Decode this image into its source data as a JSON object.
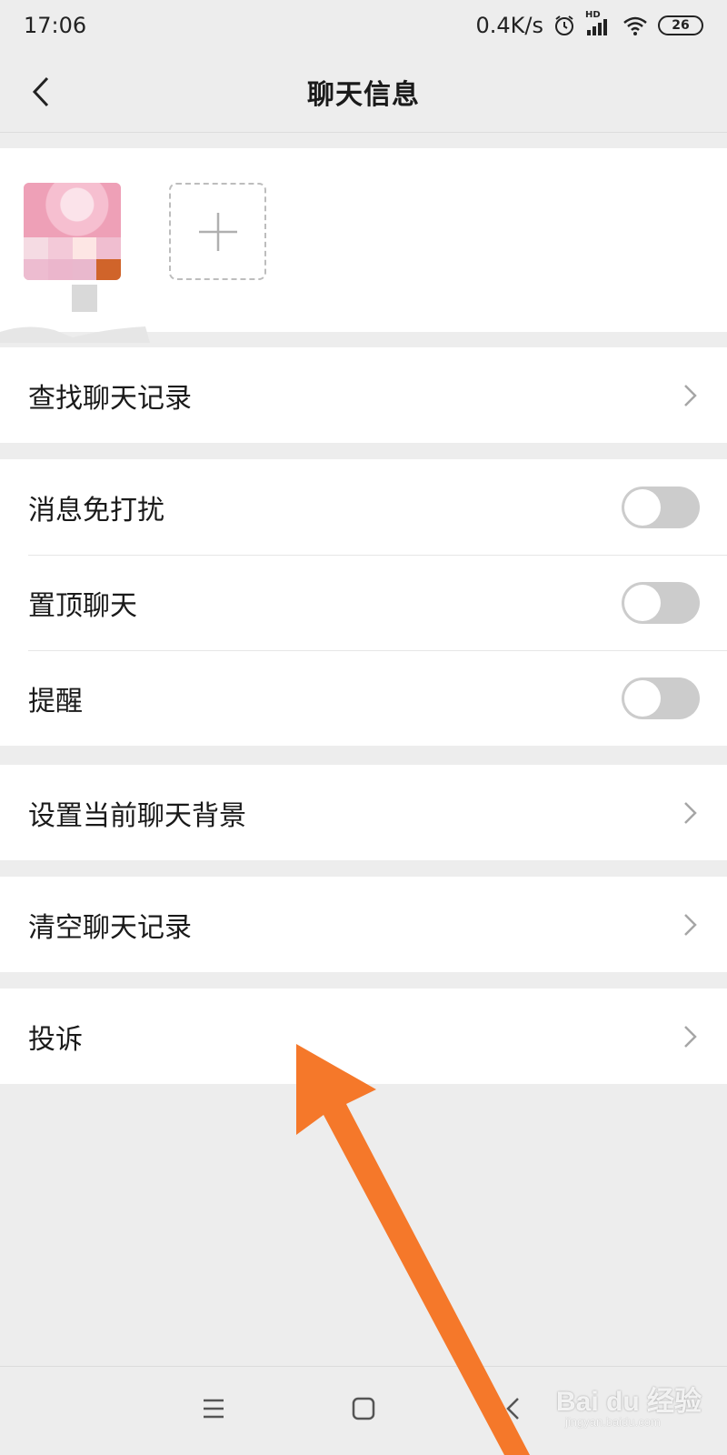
{
  "status_bar": {
    "time": "17:06",
    "net_speed": "0.4K/s",
    "hd_label": "HD",
    "battery": "26",
    "icons": [
      "alarm-icon",
      "signal-icon",
      "wifi-icon",
      "battery-icon"
    ]
  },
  "header": {
    "title": "聊天信息",
    "back_icon": "chevron-left-icon"
  },
  "members": {
    "add_icon": "plus-icon"
  },
  "search_group": {
    "items": [
      {
        "label": "查找聊天记录",
        "control": "chevron"
      }
    ]
  },
  "settings_group": {
    "items": [
      {
        "label": "消息免打扰",
        "control": "toggle",
        "on": false
      },
      {
        "label": "置顶聊天",
        "control": "toggle",
        "on": false
      },
      {
        "label": "提醒",
        "control": "toggle",
        "on": false
      }
    ]
  },
  "background_group": {
    "items": [
      {
        "label": "设置当前聊天背景",
        "control": "chevron"
      }
    ]
  },
  "clear_group": {
    "items": [
      {
        "label": "清空聊天记录",
        "control": "chevron"
      }
    ]
  },
  "complain_group": {
    "items": [
      {
        "label": "投诉",
        "control": "chevron"
      }
    ]
  },
  "system_nav": {
    "icons": [
      "menu-icon",
      "home-icon",
      "back-icon"
    ]
  },
  "watermark": {
    "text": "Bai du 经验",
    "sub": "jingyan.baidu.com"
  },
  "colors": {
    "arrow": "#f5782a",
    "toggle_off": "#cccccc",
    "background": "#ededed"
  }
}
